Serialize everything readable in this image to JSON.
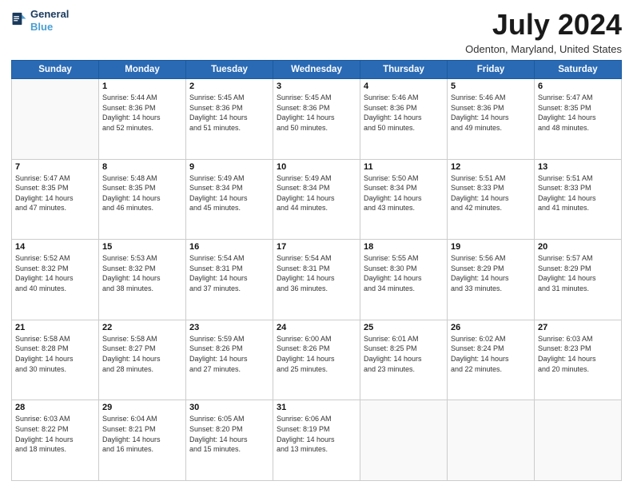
{
  "header": {
    "logo_line1": "General",
    "logo_line2": "Blue",
    "month_title": "July 2024",
    "location": "Odenton, Maryland, United States"
  },
  "weekdays": [
    "Sunday",
    "Monday",
    "Tuesday",
    "Wednesday",
    "Thursday",
    "Friday",
    "Saturday"
  ],
  "weeks": [
    [
      {
        "day": "",
        "sunrise": "",
        "sunset": "",
        "daylight": ""
      },
      {
        "day": "1",
        "sunrise": "Sunrise: 5:44 AM",
        "sunset": "Sunset: 8:36 PM",
        "daylight": "Daylight: 14 hours and 52 minutes."
      },
      {
        "day": "2",
        "sunrise": "Sunrise: 5:45 AM",
        "sunset": "Sunset: 8:36 PM",
        "daylight": "Daylight: 14 hours and 51 minutes."
      },
      {
        "day": "3",
        "sunrise": "Sunrise: 5:45 AM",
        "sunset": "Sunset: 8:36 PM",
        "daylight": "Daylight: 14 hours and 50 minutes."
      },
      {
        "day": "4",
        "sunrise": "Sunrise: 5:46 AM",
        "sunset": "Sunset: 8:36 PM",
        "daylight": "Daylight: 14 hours and 50 minutes."
      },
      {
        "day": "5",
        "sunrise": "Sunrise: 5:46 AM",
        "sunset": "Sunset: 8:36 PM",
        "daylight": "Daylight: 14 hours and 49 minutes."
      },
      {
        "day": "6",
        "sunrise": "Sunrise: 5:47 AM",
        "sunset": "Sunset: 8:35 PM",
        "daylight": "Daylight: 14 hours and 48 minutes."
      }
    ],
    [
      {
        "day": "7",
        "sunrise": "Sunrise: 5:47 AM",
        "sunset": "Sunset: 8:35 PM",
        "daylight": "Daylight: 14 hours and 47 minutes."
      },
      {
        "day": "8",
        "sunrise": "Sunrise: 5:48 AM",
        "sunset": "Sunset: 8:35 PM",
        "daylight": "Daylight: 14 hours and 46 minutes."
      },
      {
        "day": "9",
        "sunrise": "Sunrise: 5:49 AM",
        "sunset": "Sunset: 8:34 PM",
        "daylight": "Daylight: 14 hours and 45 minutes."
      },
      {
        "day": "10",
        "sunrise": "Sunrise: 5:49 AM",
        "sunset": "Sunset: 8:34 PM",
        "daylight": "Daylight: 14 hours and 44 minutes."
      },
      {
        "day": "11",
        "sunrise": "Sunrise: 5:50 AM",
        "sunset": "Sunset: 8:34 PM",
        "daylight": "Daylight: 14 hours and 43 minutes."
      },
      {
        "day": "12",
        "sunrise": "Sunrise: 5:51 AM",
        "sunset": "Sunset: 8:33 PM",
        "daylight": "Daylight: 14 hours and 42 minutes."
      },
      {
        "day": "13",
        "sunrise": "Sunrise: 5:51 AM",
        "sunset": "Sunset: 8:33 PM",
        "daylight": "Daylight: 14 hours and 41 minutes."
      }
    ],
    [
      {
        "day": "14",
        "sunrise": "Sunrise: 5:52 AM",
        "sunset": "Sunset: 8:32 PM",
        "daylight": "Daylight: 14 hours and 40 minutes."
      },
      {
        "day": "15",
        "sunrise": "Sunrise: 5:53 AM",
        "sunset": "Sunset: 8:32 PM",
        "daylight": "Daylight: 14 hours and 38 minutes."
      },
      {
        "day": "16",
        "sunrise": "Sunrise: 5:54 AM",
        "sunset": "Sunset: 8:31 PM",
        "daylight": "Daylight: 14 hours and 37 minutes."
      },
      {
        "day": "17",
        "sunrise": "Sunrise: 5:54 AM",
        "sunset": "Sunset: 8:31 PM",
        "daylight": "Daylight: 14 hours and 36 minutes."
      },
      {
        "day": "18",
        "sunrise": "Sunrise: 5:55 AM",
        "sunset": "Sunset: 8:30 PM",
        "daylight": "Daylight: 14 hours and 34 minutes."
      },
      {
        "day": "19",
        "sunrise": "Sunrise: 5:56 AM",
        "sunset": "Sunset: 8:29 PM",
        "daylight": "Daylight: 14 hours and 33 minutes."
      },
      {
        "day": "20",
        "sunrise": "Sunrise: 5:57 AM",
        "sunset": "Sunset: 8:29 PM",
        "daylight": "Daylight: 14 hours and 31 minutes."
      }
    ],
    [
      {
        "day": "21",
        "sunrise": "Sunrise: 5:58 AM",
        "sunset": "Sunset: 8:28 PM",
        "daylight": "Daylight: 14 hours and 30 minutes."
      },
      {
        "day": "22",
        "sunrise": "Sunrise: 5:58 AM",
        "sunset": "Sunset: 8:27 PM",
        "daylight": "Daylight: 14 hours and 28 minutes."
      },
      {
        "day": "23",
        "sunrise": "Sunrise: 5:59 AM",
        "sunset": "Sunset: 8:26 PM",
        "daylight": "Daylight: 14 hours and 27 minutes."
      },
      {
        "day": "24",
        "sunrise": "Sunrise: 6:00 AM",
        "sunset": "Sunset: 8:26 PM",
        "daylight": "Daylight: 14 hours and 25 minutes."
      },
      {
        "day": "25",
        "sunrise": "Sunrise: 6:01 AM",
        "sunset": "Sunset: 8:25 PM",
        "daylight": "Daylight: 14 hours and 23 minutes."
      },
      {
        "day": "26",
        "sunrise": "Sunrise: 6:02 AM",
        "sunset": "Sunset: 8:24 PM",
        "daylight": "Daylight: 14 hours and 22 minutes."
      },
      {
        "day": "27",
        "sunrise": "Sunrise: 6:03 AM",
        "sunset": "Sunset: 8:23 PM",
        "daylight": "Daylight: 14 hours and 20 minutes."
      }
    ],
    [
      {
        "day": "28",
        "sunrise": "Sunrise: 6:03 AM",
        "sunset": "Sunset: 8:22 PM",
        "daylight": "Daylight: 14 hours and 18 minutes."
      },
      {
        "day": "29",
        "sunrise": "Sunrise: 6:04 AM",
        "sunset": "Sunset: 8:21 PM",
        "daylight": "Daylight: 14 hours and 16 minutes."
      },
      {
        "day": "30",
        "sunrise": "Sunrise: 6:05 AM",
        "sunset": "Sunset: 8:20 PM",
        "daylight": "Daylight: 14 hours and 15 minutes."
      },
      {
        "day": "31",
        "sunrise": "Sunrise: 6:06 AM",
        "sunset": "Sunset: 8:19 PM",
        "daylight": "Daylight: 14 hours and 13 minutes."
      },
      {
        "day": "",
        "sunrise": "",
        "sunset": "",
        "daylight": ""
      },
      {
        "day": "",
        "sunrise": "",
        "sunset": "",
        "daylight": ""
      },
      {
        "day": "",
        "sunrise": "",
        "sunset": "",
        "daylight": ""
      }
    ]
  ]
}
